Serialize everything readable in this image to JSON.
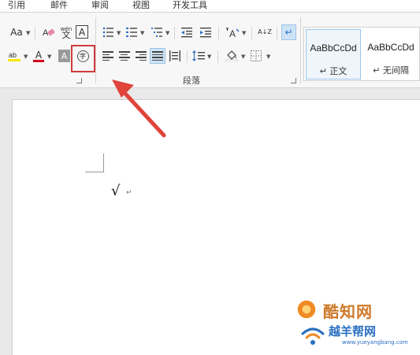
{
  "tabs": [
    "引用",
    "邮件",
    "审阅",
    "视图",
    "开发工具"
  ],
  "ribbon": {
    "font_size_label": "Aa",
    "phonetic_top": "wén",
    "phonetic_bottom": "文",
    "char_border_label": "A",
    "font_color_label": "A",
    "shading_label": "A",
    "enclose_char_label": "字",
    "sort_label": "A↓Z",
    "paragraph_group_label": "段落"
  },
  "styles": [
    {
      "preview": "AaBbCcDd",
      "name": "↵ 正文"
    },
    {
      "preview": "AaBbCcDd",
      "name": "↵ 无间隔"
    }
  ],
  "document": {
    "check_mark": "√",
    "paragraph_mark": "↵"
  },
  "watermark": {
    "title": "酷知网",
    "subtitle": "越羊帮网",
    "url": "www.yueyangbang.com"
  },
  "colors": {
    "highlight": "#d13b3b",
    "font_color": "#d6001c",
    "highlighter": "#f5e800",
    "accent": "#2a6fc2"
  }
}
